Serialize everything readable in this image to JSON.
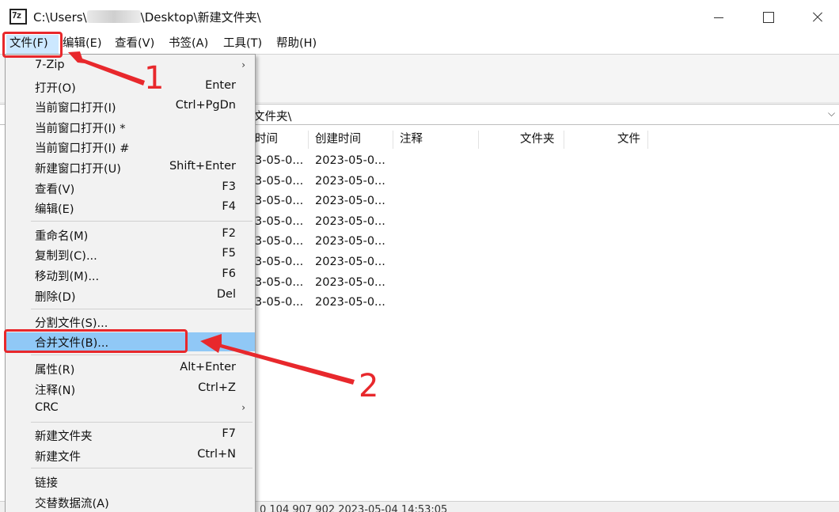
{
  "window": {
    "title_prefix": "C:\\Users\\",
    "title_suffix": "\\Desktop\\新建文件夹\\",
    "app_icon_label": "7z"
  },
  "menubar": [
    "文件(F)",
    "编辑(E)",
    "查看(V)",
    "书签(A)",
    "工具(T)",
    "帮助(H)"
  ],
  "path": "文件夹\\",
  "columns": [
    "时间",
    "创建时间",
    "注释",
    "文件夹",
    "文件"
  ],
  "rows": [
    {
      "modified": "3-05-0...",
      "created": "2023-05-0..."
    },
    {
      "modified": "3-05-0...",
      "created": "2023-05-0..."
    },
    {
      "modified": "3-05-0...",
      "created": "2023-05-0..."
    },
    {
      "modified": "3-05-0...",
      "created": "2023-05-0..."
    },
    {
      "modified": "3-05-0...",
      "created": "2023-05-0..."
    },
    {
      "modified": "3-05-0...",
      "created": "2023-05-0..."
    },
    {
      "modified": "3-05-0...",
      "created": "2023-05-0..."
    },
    {
      "modified": "3-05-0...",
      "created": "2023-05-0..."
    }
  ],
  "status": "0   104 907 902   2023-05-04 14:53:05",
  "dropdown": {
    "items": [
      {
        "label": "7-Zip",
        "shortcut": "",
        "submenu": true
      },
      {
        "label": "打开(O)",
        "shortcut": "Enter"
      },
      {
        "label": "当前窗口打开(I)",
        "shortcut": "Ctrl+PgDn"
      },
      {
        "label": "当前窗口打开(I) *",
        "shortcut": ""
      },
      {
        "label": "当前窗口打开(I) #",
        "shortcut": ""
      },
      {
        "label": "新建窗口打开(U)",
        "shortcut": "Shift+Enter"
      },
      {
        "label": "查看(V)",
        "shortcut": "F3"
      },
      {
        "label": "编辑(E)",
        "shortcut": "F4"
      },
      {
        "label": "重命名(M)",
        "shortcut": "F2"
      },
      {
        "label": "复制到(C)...",
        "shortcut": "F5"
      },
      {
        "label": "移动到(M)...",
        "shortcut": "F6"
      },
      {
        "label": "删除(D)",
        "shortcut": "Del"
      },
      {
        "label": "分割文件(S)...",
        "shortcut": ""
      },
      {
        "label": "合并文件(B)...",
        "shortcut": "",
        "highlighted": true
      },
      {
        "label": "属性(R)",
        "shortcut": "Alt+Enter"
      },
      {
        "label": "注释(N)",
        "shortcut": "Ctrl+Z"
      },
      {
        "label": "CRC",
        "shortcut": "",
        "submenu": true
      },
      {
        "label": "新建文件夹",
        "shortcut": "F7"
      },
      {
        "label": "新建文件",
        "shortcut": "Ctrl+N"
      },
      {
        "label": "链接",
        "shortcut": ""
      },
      {
        "label": "交替数据流(A)",
        "shortcut": ""
      }
    ]
  },
  "annotations": {
    "step1": "1",
    "step2": "2",
    "color": "#e8282c"
  },
  "colors": {
    "highlight": "#90c8f6",
    "menu_active": "#cce8ff",
    "annotation": "#e8282c"
  }
}
